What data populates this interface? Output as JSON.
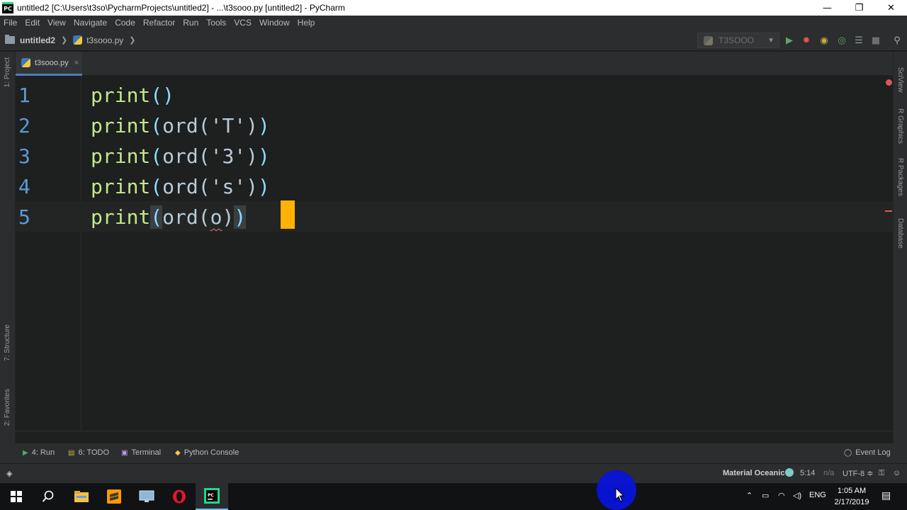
{
  "window": {
    "title": "untitled2 [C:\\Users\\t3so\\PycharmProjects\\untitled2] - ...\\t3sooo.py [untitled2] - PyCharm",
    "app_icon_text": "PC",
    "minimize": "—",
    "restore": "❐",
    "close": "✕"
  },
  "menu": [
    "File",
    "Edit",
    "View",
    "Navigate",
    "Code",
    "Refactor",
    "Run",
    "Tools",
    "VCS",
    "Window",
    "Help"
  ],
  "breadcrumb": {
    "project": "untitled2",
    "file": "t3sooo.py"
  },
  "run_config": {
    "name": "T3SOOO"
  },
  "left_tools": {
    "project": "1: Project",
    "structure": "7: Structure",
    "favorites": "2: Favorites"
  },
  "right_tools": {
    "sciview": "SciView",
    "rgraphics": "R Graphics",
    "rpackages": "R Packages",
    "database": "Database"
  },
  "tab": {
    "label": "t3sooo.py",
    "close": "×"
  },
  "editor": {
    "line_numbers": [
      "1",
      "2",
      "3",
      "4",
      "5"
    ],
    "lines": [
      {
        "fn": "print",
        "open": "(",
        "inner": "",
        "close": ")"
      },
      {
        "fn": "print",
        "open": "(",
        "inner": "ord('T')",
        "close": ")"
      },
      {
        "fn": "print",
        "open": "(",
        "inner": "ord('3')",
        "close": ")"
      },
      {
        "fn": "print",
        "open": "(",
        "inner": "ord('s')",
        "close": ")"
      }
    ],
    "line5": {
      "a": "print",
      "b": "(",
      "c": "ord(",
      "d": "o",
      "e": ")",
      "f": ")"
    }
  },
  "tool_windows": {
    "run": "4: Run",
    "todo": "6: TODO",
    "terminal": "Terminal",
    "python_console": "Python Console",
    "event_log": "Event Log"
  },
  "status": {
    "theme": "Material Oceanic",
    "position": "5:14",
    "na": "n/a",
    "encoding": "UTF-8 ≑"
  },
  "taskbar": {
    "lang": "ENG",
    "time": "1:05 AM",
    "date": "2/17/2019"
  },
  "colors": {
    "accent": "#4a7fbe",
    "caret": "#ffb300",
    "error": "#e05555",
    "function": "#c3e88d",
    "line_number": "#5b9bd5"
  }
}
